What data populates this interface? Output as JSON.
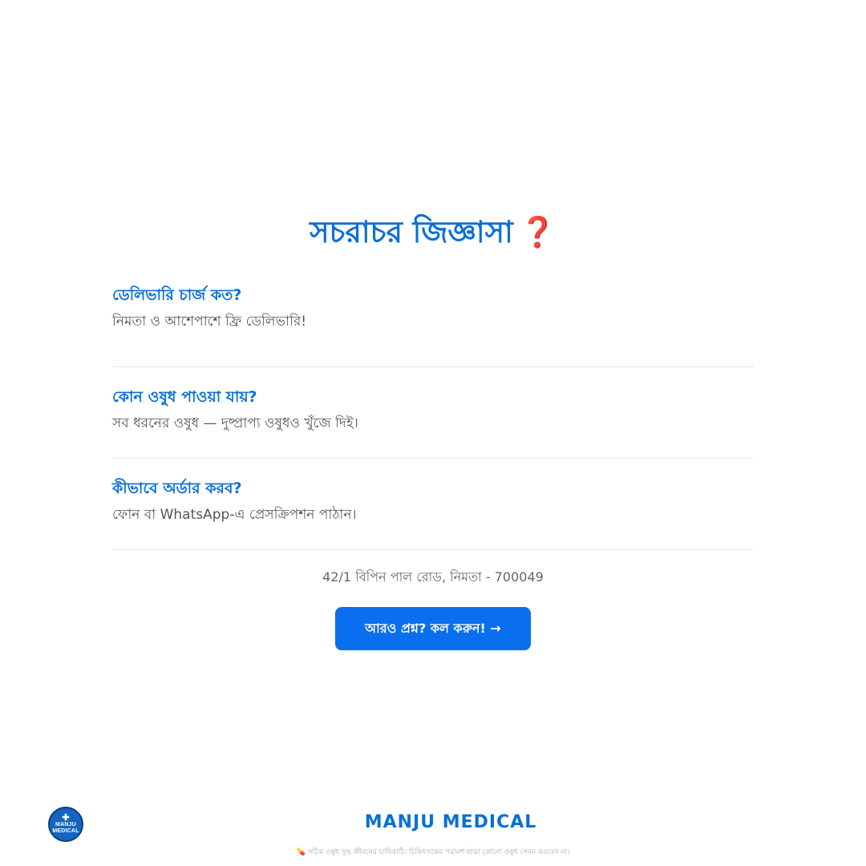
{
  "faq": {
    "title": "সচরাচর জিজ্ঞাসা",
    "title_icon": "❓",
    "items": [
      {
        "question": "ডেলিভারি চার্জ কত?",
        "answer": "নিমতা ও আশেপাশে ফ্রি ডেলিভারি!"
      },
      {
        "question": "কোন ওষুধ পাওয়া যায়?",
        "answer": "সব ধরনের ওষুধ — দুষ্প্রাপ্য ওষুধও খুঁজে দিই।"
      },
      {
        "question": "কীভাবে অর্ডার করব?",
        "answer": "ফোন বা WhatsApp-এ প্রেসক্রিপশন পাঠান।"
      }
    ]
  },
  "contact": {
    "address": "42/1 বিপিন পাল রোড, নিমতা - 700049",
    "call_button_label": "আরও প্রশ্ন? কল করুন! →"
  },
  "footer": {
    "logo_line1": "MANJU",
    "logo_line2": "MEDICAL",
    "brand_name": "MANJU MEDICAL",
    "disclaimer": "💊 সঠিক ওষুধ সুস্থ জীবনের চাবিকাঠি। চিকিৎসকের পরামর্শ ছাড়া কোনো ওষুধ সেবন করবেন না।"
  },
  "colors": {
    "accent": "#0a6fd6",
    "button": "#0a6fef",
    "question_icon": "#e53935"
  }
}
